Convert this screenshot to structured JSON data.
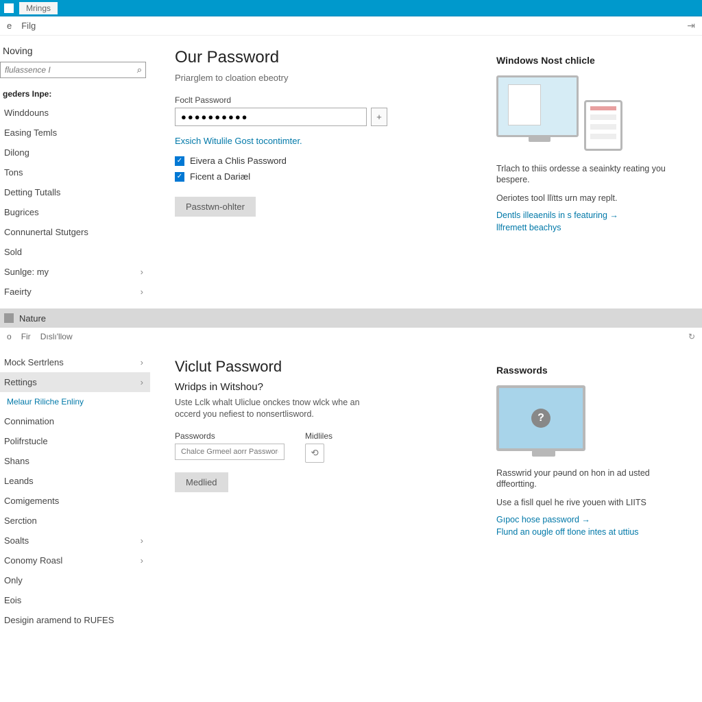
{
  "window1": {
    "title": "Mrings",
    "menu": {
      "item1": "e",
      "item2": "Filg"
    },
    "sidebar": {
      "heading": "Noving",
      "search_placeholder": "flulassence I",
      "group": "geders Inpe:",
      "items": [
        {
          "label": "Winddouns"
        },
        {
          "label": "Easing Temls"
        },
        {
          "label": "Dilong"
        },
        {
          "label": "Tons"
        },
        {
          "label": "Detting Tutalls"
        },
        {
          "label": "Bugrices"
        },
        {
          "label": "Connunertal Stutgers"
        },
        {
          "label": "Sold"
        },
        {
          "label": "Sunlge: my",
          "chev": true
        },
        {
          "label": "Faeirty",
          "chev": true
        }
      ]
    },
    "main": {
      "title": "Our Password",
      "subtitle": "Priarglem to cloation ebeotry",
      "field_label": "Foclt Password",
      "password_value": "●●●●●●●●●●",
      "link1": "Exsich Witulile Gost tocontimter.",
      "check1": "Eivera a Chlis Password",
      "check2": "Ficent a Dariæl",
      "button": "Passtwn-ohlter"
    },
    "aside": {
      "title": "Windows Nost chlicle",
      "p1": "Trlach to thiis ordesse a seainkty reating you bespere.",
      "p2": "Oeriotes tool llïtts urn may replt.",
      "link1": "Dentls illeaenils in s featuring →",
      "link2": "llfremett beachys"
    }
  },
  "window2": {
    "title": "Nature",
    "menu": {
      "item1": "o",
      "item2": "Fir",
      "item3": "Dıslı'llow"
    },
    "sidebar": {
      "items": [
        {
          "label": "Mock Sertrlens",
          "chev": true
        },
        {
          "label": "Rettings",
          "chev": true,
          "active": true
        },
        {
          "label": "Melaur Riliche Enliny",
          "sub": true
        },
        {
          "label": "Connimation"
        },
        {
          "label": "Polifrstucle"
        },
        {
          "label": "Shans"
        },
        {
          "label": "Leands"
        },
        {
          "label": "Comigements"
        },
        {
          "label": "Serction"
        },
        {
          "label": "Soalts",
          "chev": true
        },
        {
          "label": "Conomy Roasl",
          "chev": true
        },
        {
          "label": "Only"
        },
        {
          "label": "Eois"
        },
        {
          "label": "Desigin aramend to RUFES"
        }
      ]
    },
    "main": {
      "title": "Viclut Password",
      "q": "Wridps in Witshou?",
      "desc": "Uste Lclk whalt Uliclue onckes tnow wlck whe an occerd you nefiest to nonsertlisword.",
      "col1_label": "Passwords",
      "col1_placeholder": "Chalce Grmeel aorr Password",
      "col2_label": "Midliles",
      "button": "Medlied"
    },
    "aside": {
      "title": "Rasswords",
      "p1": "Rasswrid your pəund on hon in ad usted dffeortting.",
      "p2": "Use a fisll quel he rive youen with LIITS",
      "link1": "Gıpoc hose password →",
      "link2": "Flund an ougle off tlone intes at uttius"
    }
  }
}
